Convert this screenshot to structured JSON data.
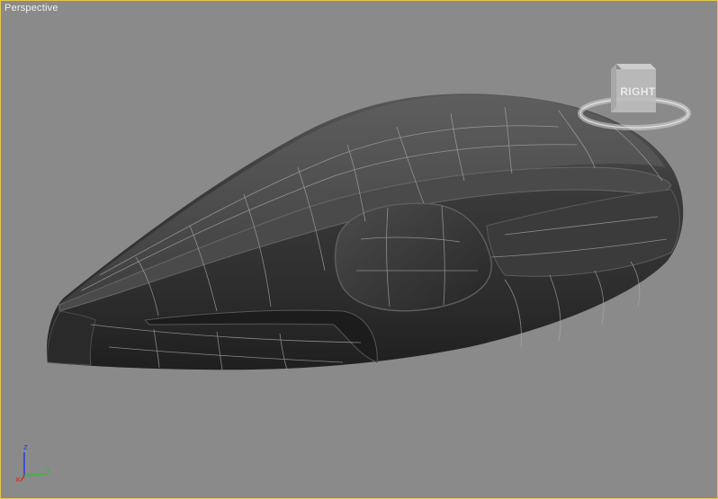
{
  "viewport": {
    "label": "Perspective",
    "border_color": "#e6c74a",
    "background_color": "#8a8a8a"
  },
  "viewcube": {
    "face_label": "RIGHT",
    "icon": "viewcube-icon"
  },
  "axis_gizmo": {
    "z_label": "z",
    "y_label": "y",
    "x_label": "x",
    "z_color": "#2a3fd6",
    "y_color": "#2fbf2f",
    "x_color": "#d62a2a"
  },
  "model": {
    "icon": "shaded-mesh-icon",
    "wireframe_color": "#a9a9a9"
  }
}
